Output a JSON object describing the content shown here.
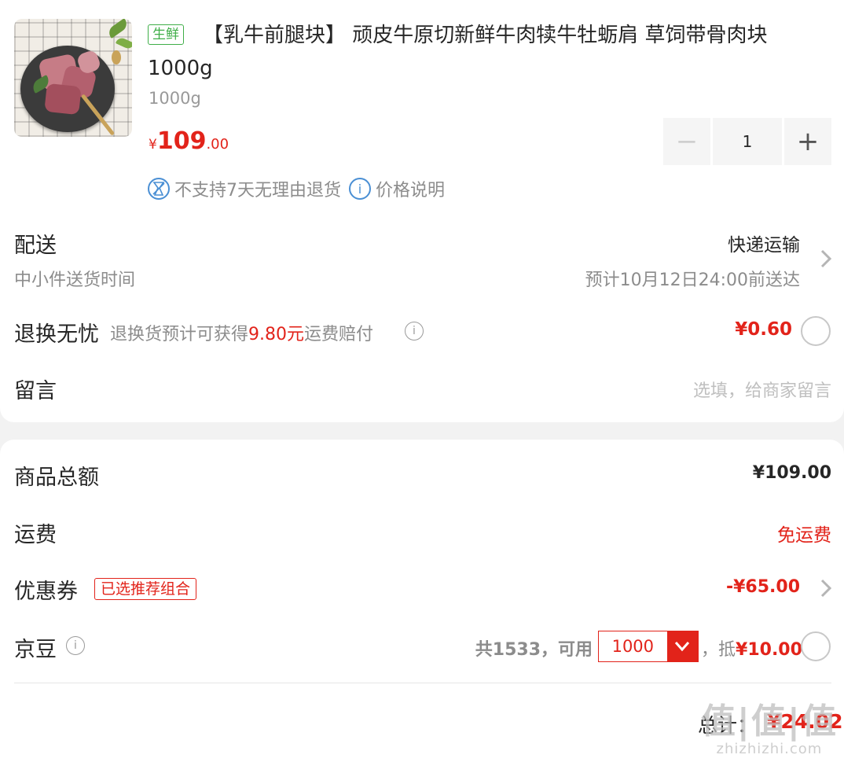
{
  "product": {
    "tag": "生鲜",
    "title": "【乳牛前腿块】 顽皮牛原切新鲜牛肉犊牛牡蛎肩 草饲带骨肉块1000g",
    "spec": "1000g",
    "price_symbol": "¥",
    "price_int": "109",
    "price_dec": ".00",
    "quantity": "1",
    "minus_label": "−",
    "plus_label": "+",
    "notice_no_return": "不支持7天无理由退货",
    "notice_price_info": "价格说明"
  },
  "delivery": {
    "label": "配送",
    "method": "快递运输",
    "sub_label": "中小件送货时间",
    "eta": "预计10月12日24:00前送达"
  },
  "return_insurance": {
    "label": "退换无忧",
    "desc_prefix": "退换货预计可获得",
    "desc_amount": "9.80元",
    "desc_suffix": "运费赔付",
    "price": "¥0.60"
  },
  "message": {
    "label": "留言",
    "placeholder": "选填，给商家留言"
  },
  "summary": {
    "goods_total_label": "商品总额",
    "goods_total_value": "¥109.00",
    "shipping_label": "运费",
    "shipping_value": "免运费",
    "coupon_label": "优惠券",
    "coupon_tag": "已选推荐组合",
    "coupon_value": "-¥65.00",
    "jd_bean_label": "京豆",
    "jd_bean_available": "共1533，可用",
    "jd_bean_selected": "1000",
    "jd_bean_deduct_prefix": "，抵",
    "jd_bean_deduct_value": "¥10.00",
    "total_label": "总计：",
    "total_value": "¥24.02"
  },
  "watermark": {
    "big": "值|值|值",
    "small": "zhizhizhi.com"
  },
  "colors": {
    "accent_red": "#e2231a",
    "fresh_green": "#3fae48",
    "info_blue": "#4a8fd4"
  }
}
